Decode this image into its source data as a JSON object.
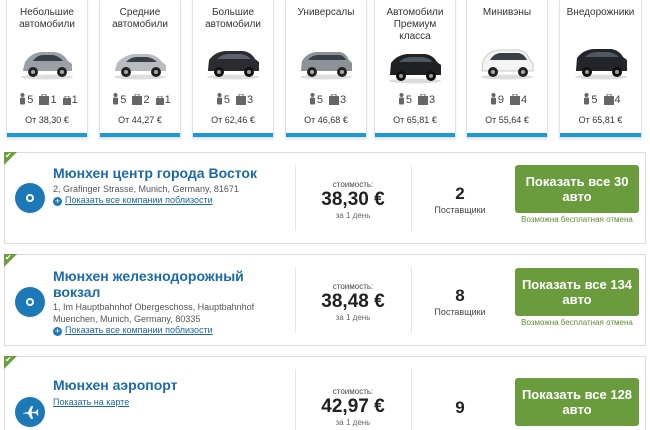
{
  "categories": [
    {
      "name": "Небольшие автомобили",
      "people": "5",
      "bags_large": "1",
      "bags_small": "1",
      "price": "От 38,30 €",
      "color": "#9aa0a6"
    },
    {
      "name": "Средние автомобили",
      "people": "5",
      "bags_large": "2",
      "bags_small": "1",
      "price": "От 44,27 €",
      "color": "#b8bcc0"
    },
    {
      "name": "Большие автомобили",
      "people": "5",
      "bags_large": "3",
      "price": "От 62,46 €",
      "color": "#2a2c30"
    },
    {
      "name": "Универсалы",
      "people": "5",
      "bags_large": "3",
      "price": "От 46,68 €",
      "color": "#8d9298"
    },
    {
      "name": "Автомобили Премиум класса",
      "people": "5",
      "bags_large": "3",
      "price": "От 65,81 €",
      "color": "#1e2024"
    },
    {
      "name": "Минивэны",
      "people": "9",
      "bags_large": "4",
      "price": "От 55,64 €",
      "color": "#eeeeee"
    },
    {
      "name": "Внедорожники",
      "people": "5",
      "bags_large": "4",
      "price": "От 65,81 €",
      "color": "#23252a"
    }
  ],
  "locations": [
    {
      "title": "Мюнхен центр города Восток",
      "address": "2, Grafinger Strasse, Munich, Germany, 81671",
      "nearby": "Показать все компании поблизости",
      "cost_label": "стоимость:",
      "price": "38,30 €",
      "per_day": "за 1 день",
      "providers": "2",
      "providers_label": "Поставщики",
      "button": "Показать все 30 авто",
      "free_cancel": "Возможна бесплатная отмена"
    },
    {
      "title_line1": "Мюнхен железнодорожный",
      "title_line2": "вокзал",
      "address_line1": "1, Im Hauptbahnhof Obergeschoss, Hauptbahnhof",
      "address_line2": "Muenchen, Munich, Germany, 80335",
      "nearby": "Показать все компании поблизости",
      "cost_label": "стоимость:",
      "price": "38,48 €",
      "per_day": "за 1 день",
      "providers": "8",
      "providers_label": "Поставщики",
      "button": "Показать все 134 авто",
      "free_cancel": "Возможна бесплатная отмена"
    },
    {
      "title": "Мюнхен аэропорт",
      "map_link": "Показать на карте",
      "cost_label": "стоимость:",
      "price": "42,97 €",
      "per_day": "за 1 день",
      "providers": "9",
      "button": "Показать все 128 авто"
    }
  ]
}
